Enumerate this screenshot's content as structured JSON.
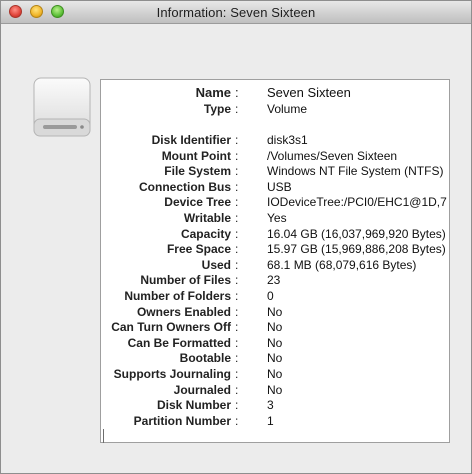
{
  "window": {
    "title": "Information: Seven Sixteen"
  },
  "icons": {
    "drive": "external-drive-icon"
  },
  "header_rows": [
    {
      "label": "Name",
      "value": "Seven Sixteen"
    },
    {
      "label": "Type",
      "value": "Volume"
    }
  ],
  "rows": [
    {
      "label": "Disk Identifier",
      "value": "disk3s1"
    },
    {
      "label": "Mount Point",
      "value": "/Volumes/Seven Sixteen"
    },
    {
      "label": "File System",
      "value": "Windows NT File System (NTFS)"
    },
    {
      "label": "Connection Bus",
      "value": "USB"
    },
    {
      "label": "Device Tree",
      "value": "IODeviceTree:/PCI0/EHC1@1D,7"
    },
    {
      "label": "Writable",
      "value": "Yes"
    },
    {
      "label": "Capacity",
      "value": "16.04 GB (16,037,969,920 Bytes)"
    },
    {
      "label": "Free Space",
      "value": "15.97 GB (15,969,886,208 Bytes)"
    },
    {
      "label": "Used",
      "value": "68.1 MB (68,079,616 Bytes)"
    },
    {
      "label": "Number of Files",
      "value": "23"
    },
    {
      "label": "Number of Folders",
      "value": "0"
    },
    {
      "label": "Owners Enabled",
      "value": "No"
    },
    {
      "label": "Can Turn Owners Off",
      "value": "No"
    },
    {
      "label": "Can Be Formatted",
      "value": "No"
    },
    {
      "label": "Bootable",
      "value": "No"
    },
    {
      "label": "Supports Journaling",
      "value": "No"
    },
    {
      "label": "Journaled",
      "value": "No"
    },
    {
      "label": "Disk Number",
      "value": "3"
    },
    {
      "label": "Partition Number",
      "value": "1"
    }
  ]
}
